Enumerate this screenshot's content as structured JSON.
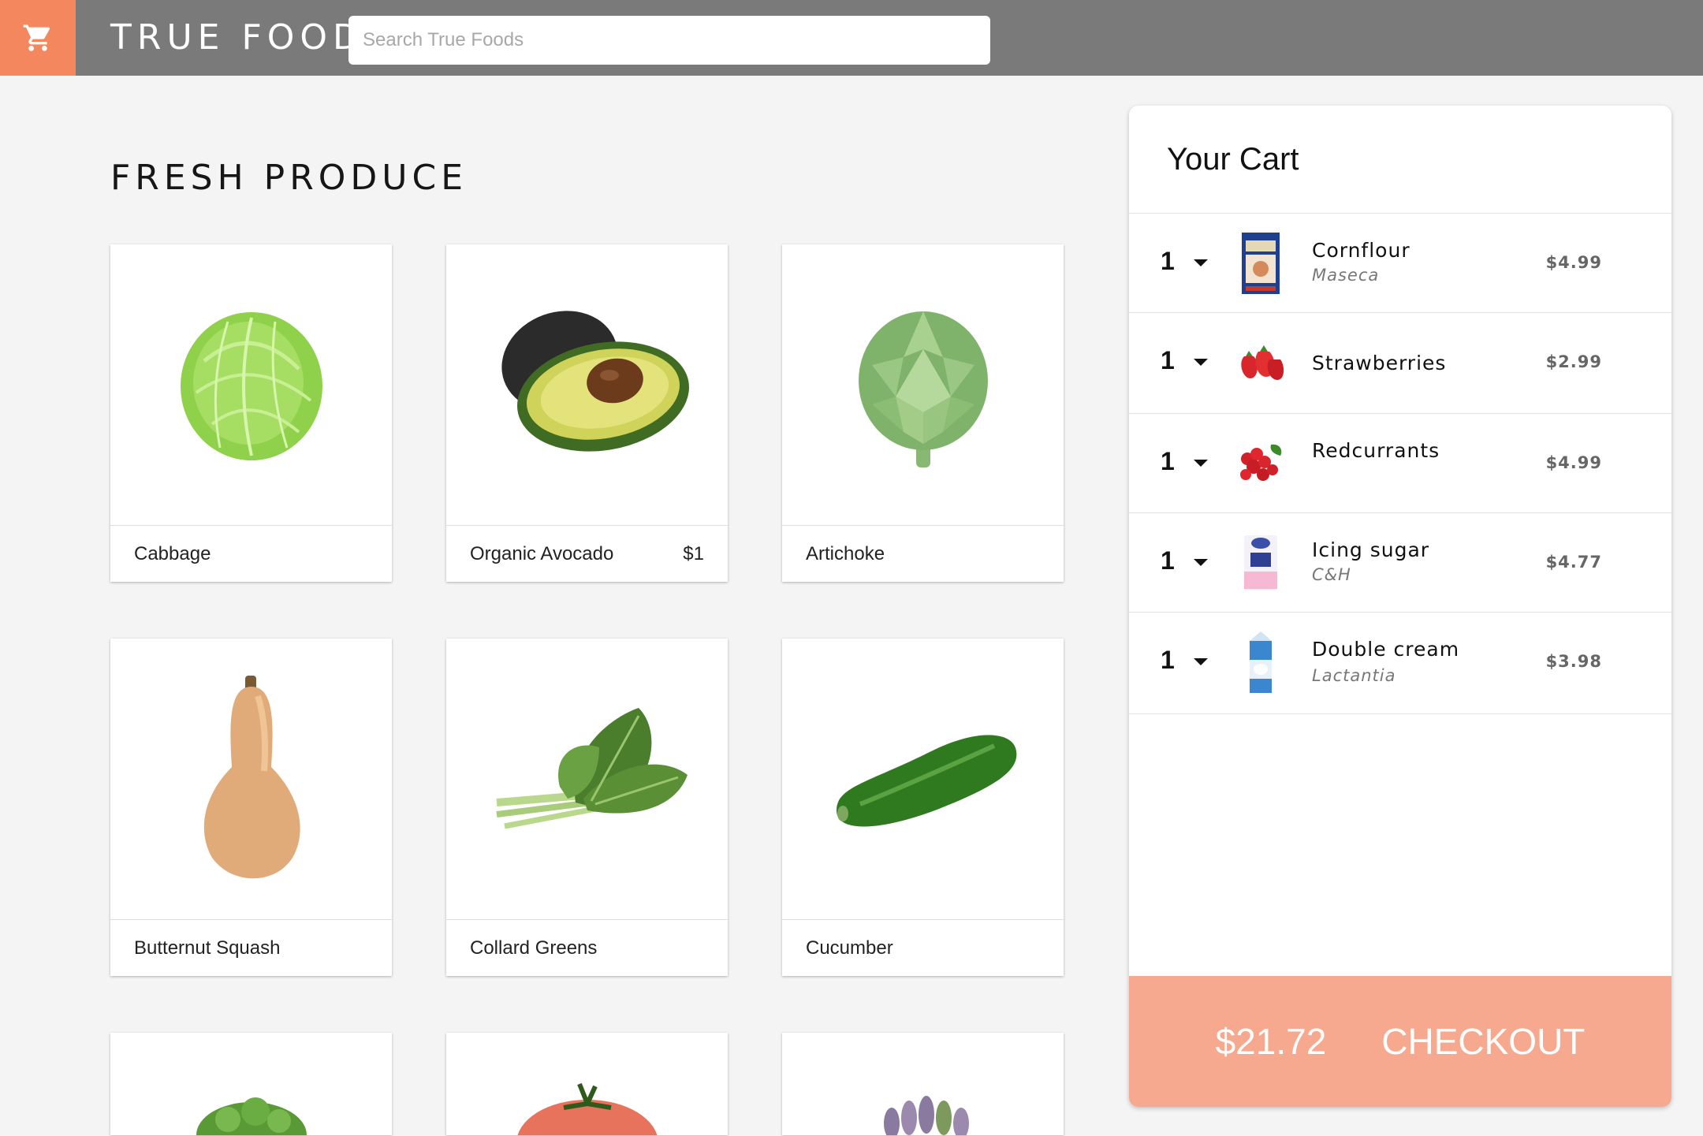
{
  "header": {
    "brand": "TRUE FOODS",
    "search_placeholder": "Search True Foods",
    "cart_icon": "shopping-cart-icon"
  },
  "section": {
    "title": "FRESH PRODUCE"
  },
  "products": [
    {
      "name": "Cabbage",
      "price": ""
    },
    {
      "name": "Organic Avocado",
      "price": "$1"
    },
    {
      "name": "Artichoke",
      "price": ""
    },
    {
      "name": "Butternut Squash",
      "price": ""
    },
    {
      "name": "Collard Greens",
      "price": ""
    },
    {
      "name": "Cucumber",
      "price": ""
    }
  ],
  "cart": {
    "title": "Your Cart",
    "items": [
      {
        "qty": "1",
        "name": "Cornflour",
        "brand": "Maseca",
        "price": "$4.99"
      },
      {
        "qty": "1",
        "name": "Strawberries",
        "brand": "",
        "price": "$2.99"
      },
      {
        "qty": "1",
        "name": "Redcurrants",
        "brand": "",
        "price": "$4.99"
      },
      {
        "qty": "1",
        "name": "Icing sugar",
        "brand": "C&H",
        "price": "$4.77"
      },
      {
        "qty": "1",
        "name": "Double cream",
        "brand": "Lactantia",
        "price": "$3.98"
      }
    ],
    "total": "$21.72",
    "checkout_label": "CHECKOUT"
  },
  "colors": {
    "accent": "#f4875d",
    "checkout_bg": "#f6a98e",
    "header_bg": "#7a7a7a",
    "page_bg": "#f4f4f4"
  }
}
